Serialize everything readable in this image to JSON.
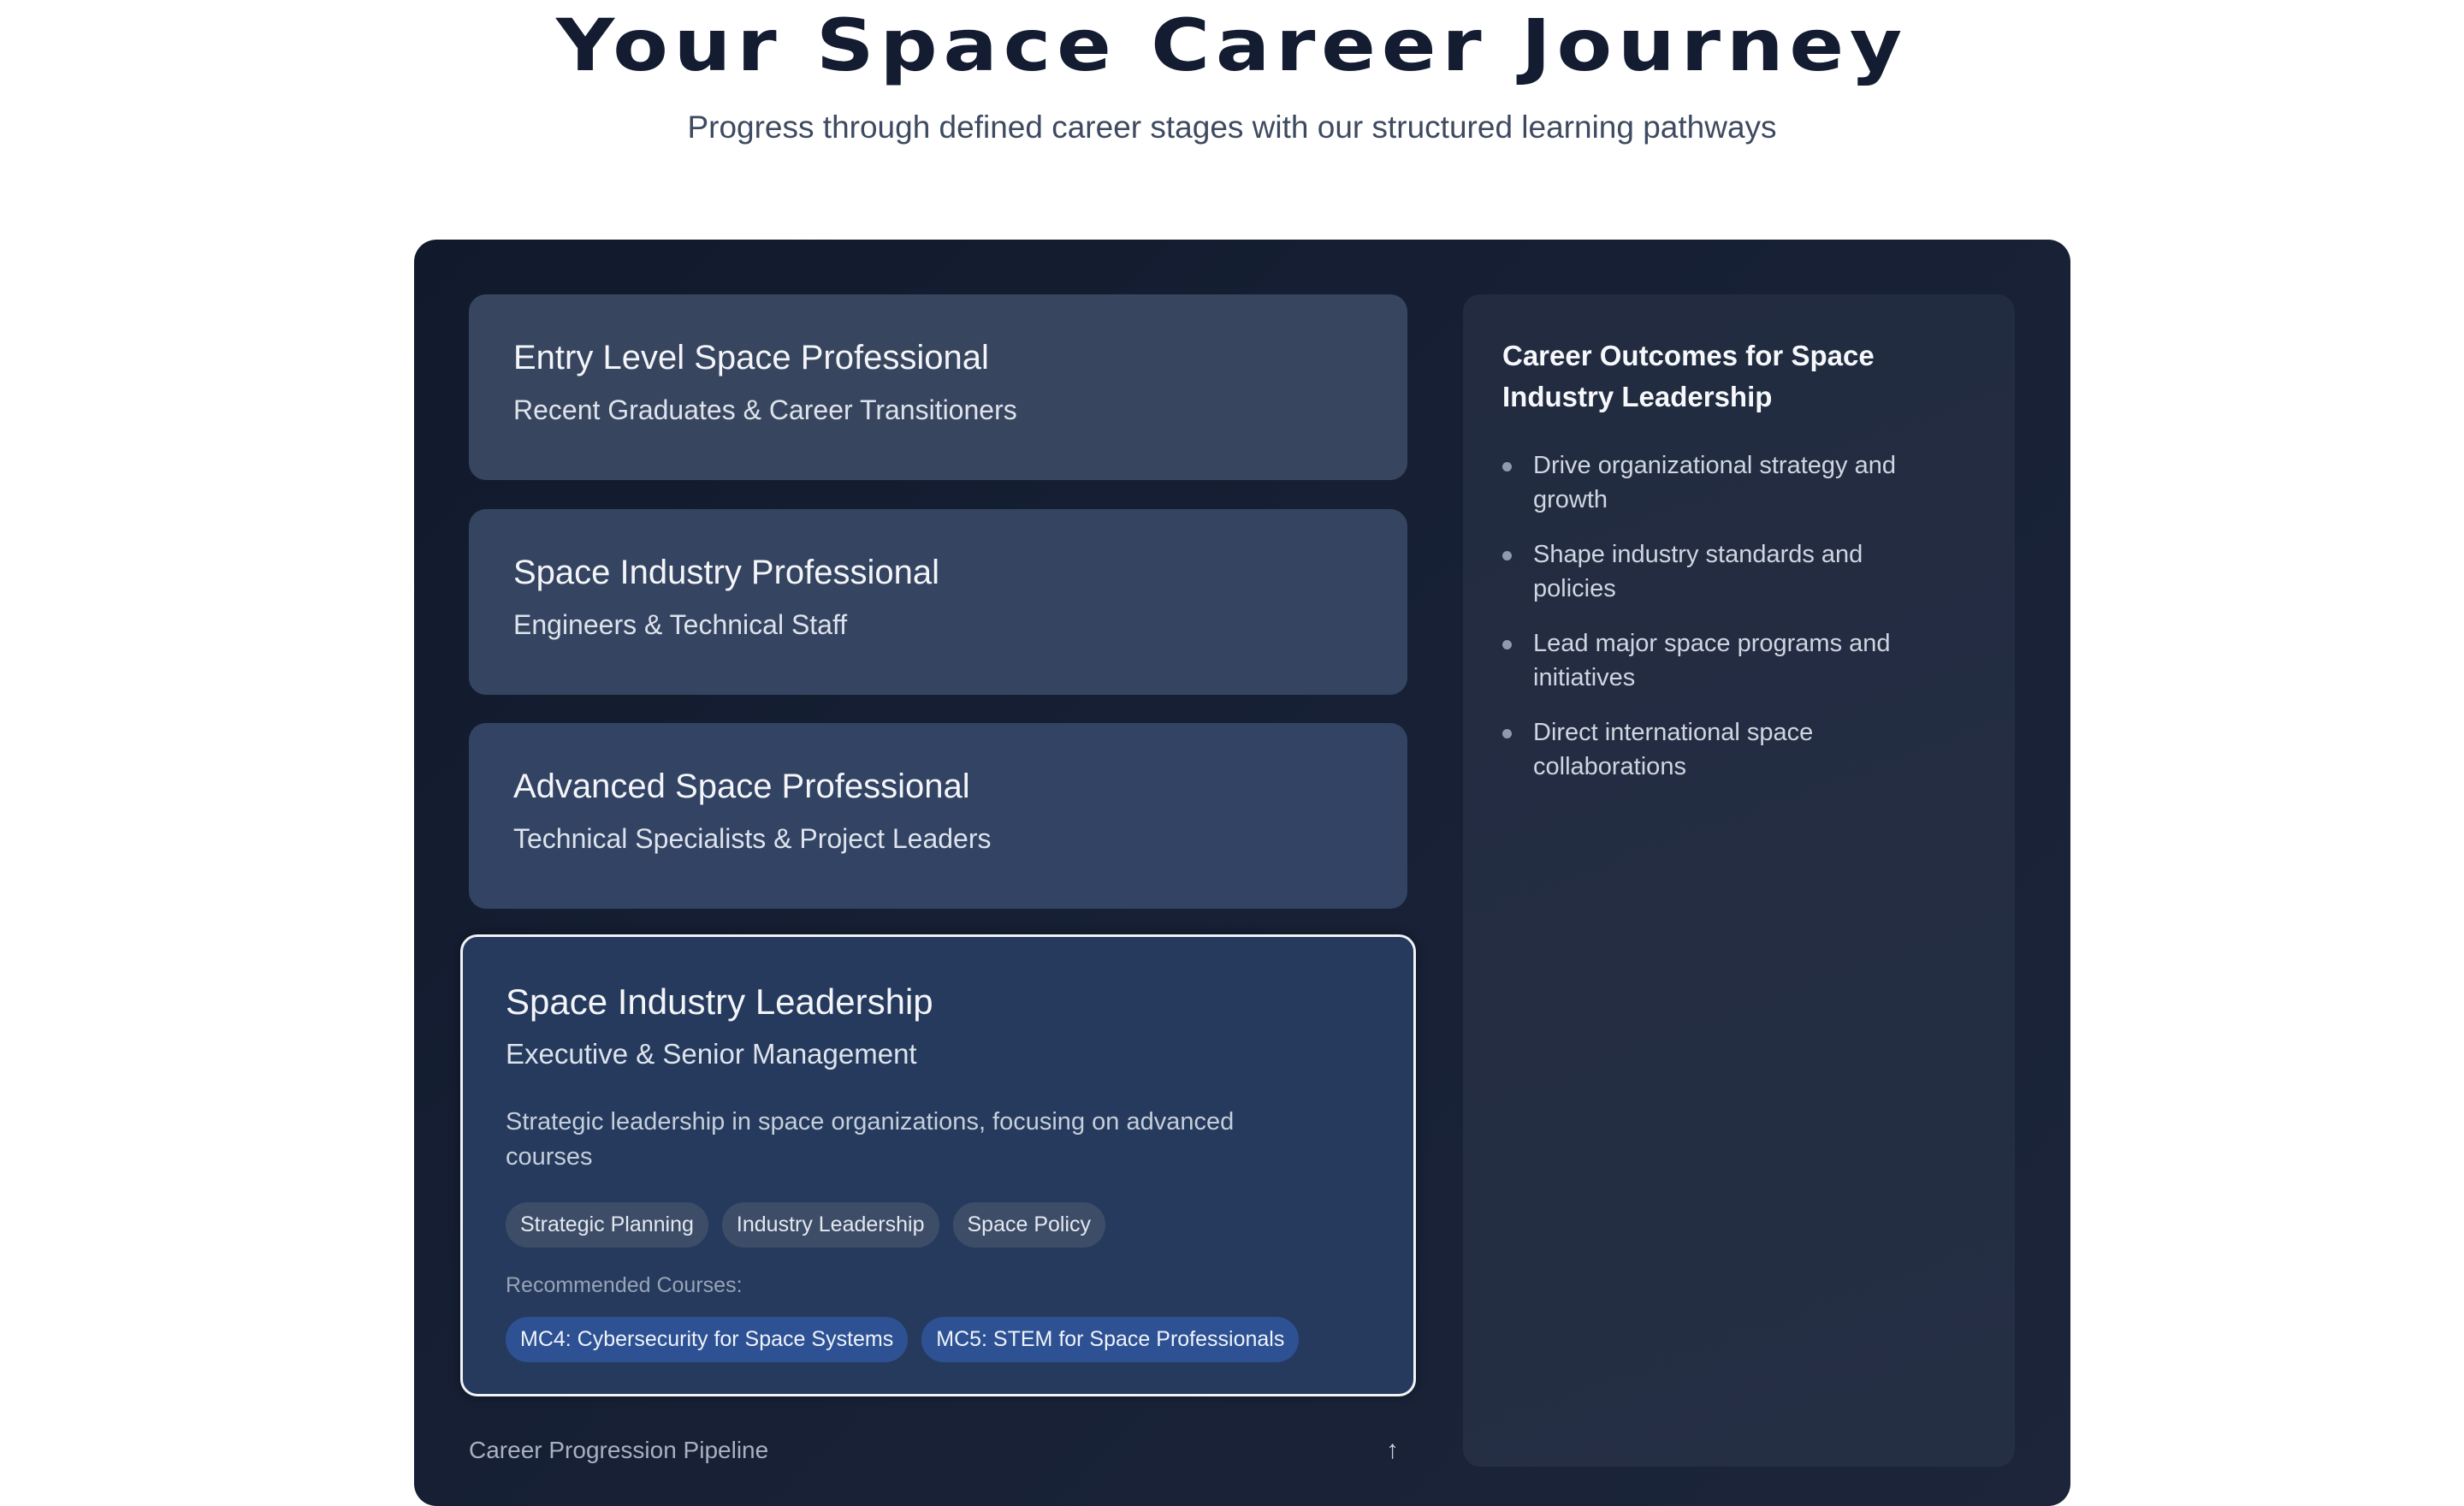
{
  "header": {
    "title": "Your Space Career Journey",
    "subtitle": "Progress through defined career stages with our structured learning pathways"
  },
  "stages": [
    {
      "title": "Entry Level Space Professional",
      "audience": "Recent Graduates & Career Transitioners"
    },
    {
      "title": "Space Industry Professional",
      "audience": "Engineers & Technical Staff"
    },
    {
      "title": "Advanced Space Professional",
      "audience": "Technical Specialists & Project Leaders"
    }
  ],
  "selected_stage": {
    "title": "Space Industry Leadership",
    "audience": "Executive & Senior Management",
    "description": "Strategic leadership in space organizations, focusing on advanced courses",
    "tags": [
      "Strategic Planning",
      "Industry Leadership",
      "Space Policy"
    ],
    "recommended_label": "Recommended Courses:",
    "courses": [
      "MC4: Cybersecurity for Space Systems",
      "MC5: STEM for Space Professionals"
    ]
  },
  "pipeline": {
    "label": "Career Progression Pipeline",
    "icon": "arrow-up-icon",
    "icon_glyph": "↑"
  },
  "outcomes": {
    "title": "Career Outcomes for Space Industry Leadership",
    "items": [
      "Drive organizational strategy and growth",
      "Shape industry standards and policies",
      "Lead major space programs and initiatives",
      "Direct international space collaborations"
    ]
  },
  "colors": {
    "title": "#131c31",
    "panel_bg": "#111a2c",
    "card_bg": "#38465e",
    "selected_card_bg": "#253a5c",
    "course_pill": "#2d5192",
    "tag_pill": "#3e4d67"
  }
}
